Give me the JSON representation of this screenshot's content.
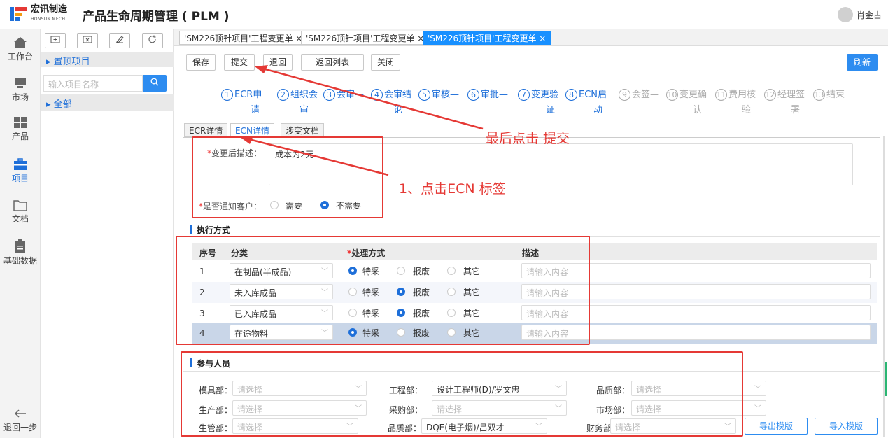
{
  "brand": {
    "name": "宏讯制造",
    "sub": "HONSUN MECH"
  },
  "app_title": "产品生命周期管理 ( PLM )",
  "user": {
    "name": "肖金古"
  },
  "nav": [
    {
      "label": "工作台",
      "icon": "home-icon"
    },
    {
      "label": "市场",
      "icon": "market-icon"
    },
    {
      "label": "产品",
      "icon": "grid-icon"
    },
    {
      "label": "项目",
      "icon": "briefcase-icon"
    },
    {
      "label": "文档",
      "icon": "folder-icon"
    },
    {
      "label": "基础数据",
      "icon": "data-icon"
    }
  ],
  "back_step": "退回一步",
  "tree": {
    "pinned": "置顶项目",
    "search_placeholder": "输入项目名称",
    "all": "全部"
  },
  "tabs": [
    {
      "label": "'SM226顶针项目'工程变更单 ×"
    },
    {
      "label": "'SM226顶针项目'工程变更单 ×"
    },
    {
      "label": "'SM226顶针项目'工程变更单 ×"
    }
  ],
  "toolbar": {
    "save": "保存",
    "submit": "提交",
    "back": "退回",
    "return_list": "返回列表",
    "close": "关闭",
    "refresh": "刷新"
  },
  "steps": [
    {
      "num": "1",
      "label": "ECR申",
      "label2": "请"
    },
    {
      "num": "2",
      "label": "组织会",
      "label2": "审"
    },
    {
      "num": "3",
      "label": "会审—",
      "label2": ""
    },
    {
      "num": "4",
      "label": "会审结",
      "label2": "论"
    },
    {
      "num": "5",
      "label": "审核—",
      "label2": ""
    },
    {
      "num": "6",
      "label": "审批—",
      "label2": ""
    },
    {
      "num": "7",
      "label": "变更验",
      "label2": "证"
    },
    {
      "num": "8",
      "label": "ECN启",
      "label2": "动"
    },
    {
      "num": "9",
      "label": "会签—",
      "label2": ""
    },
    {
      "num": "10",
      "label": "变更确",
      "label2": "认"
    },
    {
      "num": "11",
      "label": "费用核",
      "label2": "验"
    },
    {
      "num": "12",
      "label": "经理签",
      "label2": "署"
    },
    {
      "num": "13",
      "label": "结束",
      "label2": ""
    }
  ],
  "subtabs": {
    "ecr": "ECR详情",
    "ecn": "ECN详情",
    "docs": "涉变文档"
  },
  "form": {
    "desc_label": "变更后描述：",
    "desc_value": "成本为2元",
    "notify_label": "是否通知客户：",
    "notify_yes": "需要",
    "notify_no": "不需要"
  },
  "exec": {
    "title": "执行方式",
    "headers": {
      "no": "序号",
      "cat": "分类",
      "method": "处理方式",
      "desc": "描述"
    },
    "opt_special": "特采",
    "opt_scrap": "报废",
    "opt_other": "其它",
    "placeholder": "请输入内容",
    "rows": [
      {
        "no": "1",
        "cat": "在制品(半成品)",
        "selected": "special"
      },
      {
        "no": "2",
        "cat": "未入库成品",
        "selected": "scrap"
      },
      {
        "no": "3",
        "cat": "已入库成品",
        "selected": "scrap"
      },
      {
        "no": "4",
        "cat": "在途物料",
        "selected": "special"
      }
    ]
  },
  "people": {
    "title": "参与人员",
    "placeholder": "请选择",
    "mold": "模具部：",
    "engineering": "工程部：",
    "engineering_value": "设计工程师(D)/罗文忠",
    "quality": "品质部：",
    "production": "生产部：",
    "purchasing": "采购部：",
    "marketing": "市场部：",
    "prod_mgmt": "生管部：",
    "quality2": "品质部：",
    "quality2_value": "DQE(电子烟)/吕双才",
    "finance": "财务部：",
    "export": "导出模版",
    "import": "导入模版"
  },
  "annotations": {
    "submit_note": "最后点击 提交",
    "ecn_note": "1、点击ECN 标签"
  },
  "colors": {
    "accent": "#1e6fd9",
    "annotation": "#e53935",
    "button_primary": "#2d8cf0"
  }
}
